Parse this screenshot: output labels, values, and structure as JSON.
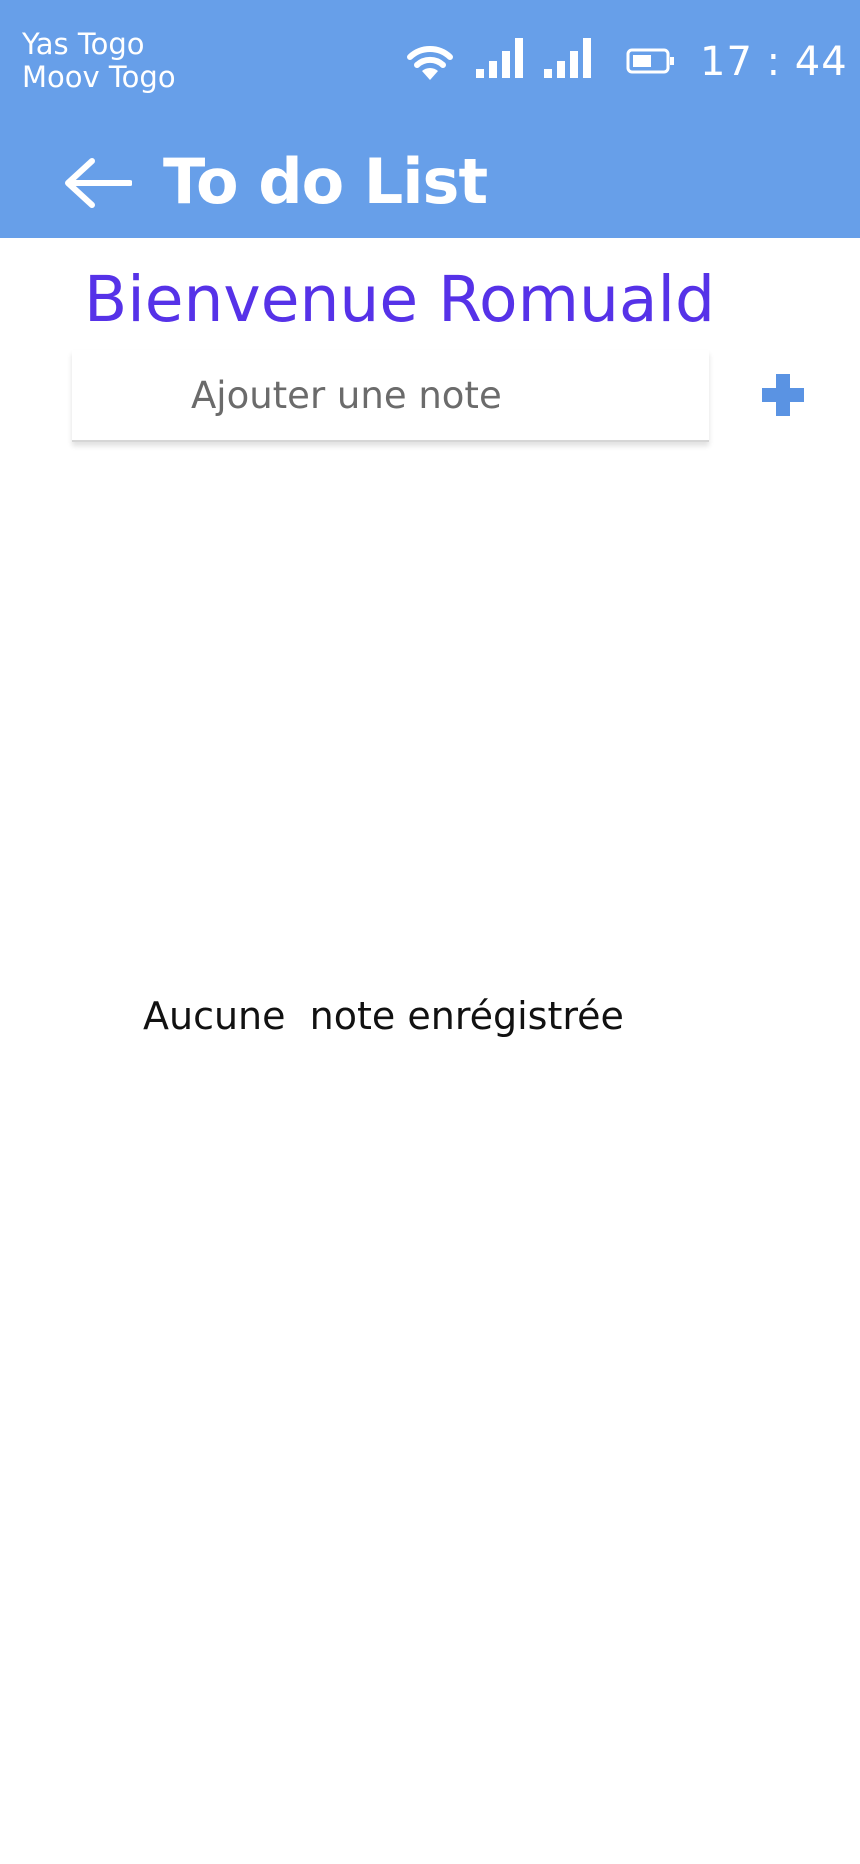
{
  "status_bar": {
    "carrier_1": "Yas Togo",
    "carrier_2": "Moov Togo",
    "time": "17 : 44",
    "icons": [
      "wifi-icon",
      "signal-icon",
      "signal-icon",
      "battery-icon"
    ]
  },
  "app_bar": {
    "title": "To do List",
    "back_icon": "arrow-left-icon",
    "color": "#679fe9"
  },
  "main": {
    "welcome": "Bienvenue Romuald",
    "welcome_color": "#5632e8",
    "note_input": {
      "placeholder": "Ajouter une note",
      "value": ""
    },
    "add_icon": "plus-icon",
    "empty_message": "Aucune  note enrégistrée"
  }
}
